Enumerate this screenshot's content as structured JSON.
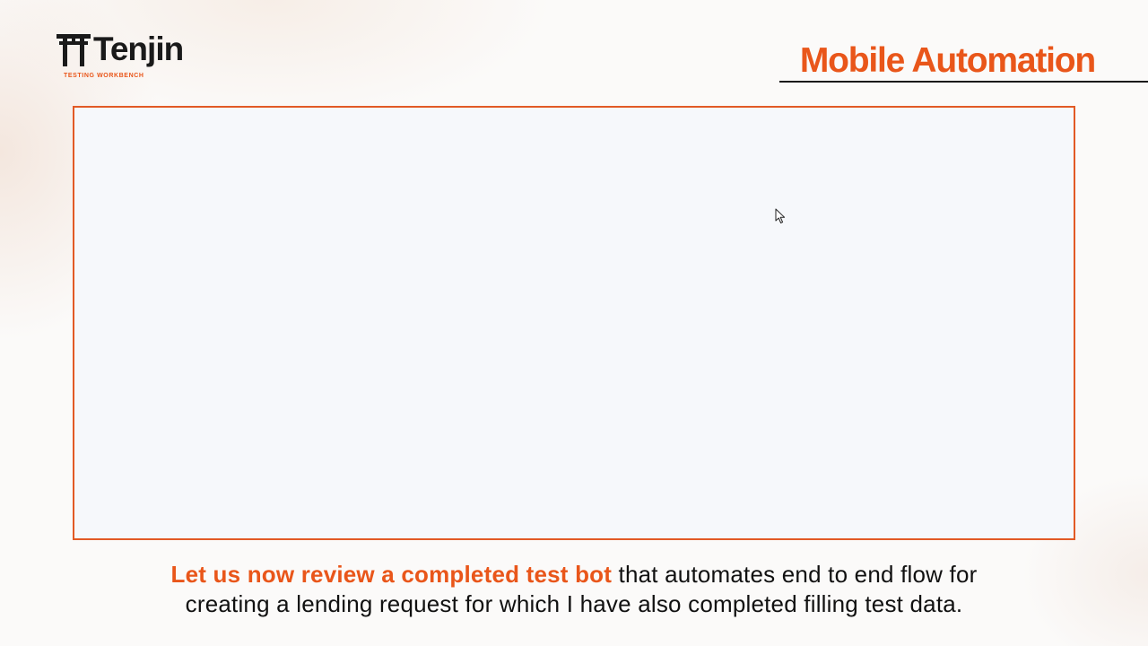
{
  "logo": {
    "icon": "torii-gate-icon",
    "word": "Tenjin",
    "tagline": "TESTING WORKBENCH"
  },
  "header": {
    "title": "Mobile Automation"
  },
  "content": {
    "cursor_icon": "mouse-pointer-icon"
  },
  "caption": {
    "highlight": "Let us now review a completed test bot",
    "line1_rest": " that automates end to end flow for",
    "line2": "creating a lending request for which I have also completed filling test data."
  },
  "colors": {
    "accent": "#e9561a",
    "frame_border": "#e25a25",
    "text": "#111111",
    "frame_fill": "#f6f8fb"
  }
}
